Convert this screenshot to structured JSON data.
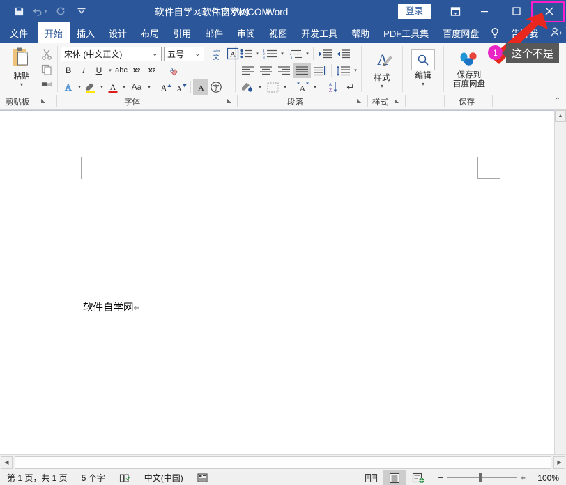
{
  "titlebar": {
    "quick_access": [
      {
        "name": "save-icon",
        "label": "保存"
      },
      {
        "name": "undo-icon",
        "label": "撤消"
      },
      {
        "name": "redo-icon",
        "label": "恢复"
      },
      {
        "name": "customize-qat-icon",
        "label": "自定义快速访问工具栏"
      }
    ],
    "document_title": "软件自学网：RJZXW.COM",
    "app_title_doc": "软件自学网",
    "app_title_sep": "-",
    "app_title": "Word",
    "signin_label": "登录",
    "ribbon_display_options": "功能区显示选项",
    "minimize_label": "最小化",
    "maximize_label": "最大化",
    "close_label": "关闭",
    "highlight_color": "#ff1ecb"
  },
  "tabs": [
    {
      "label": "文件",
      "active": false
    },
    {
      "label": "开始",
      "active": true
    },
    {
      "label": "插入",
      "active": false
    },
    {
      "label": "设计",
      "active": false
    },
    {
      "label": "布局",
      "active": false
    },
    {
      "label": "引用",
      "active": false
    },
    {
      "label": "邮件",
      "active": false
    },
    {
      "label": "审阅",
      "active": false
    },
    {
      "label": "视图",
      "active": false
    },
    {
      "label": "开发工具",
      "active": false
    },
    {
      "label": "帮助",
      "active": false
    },
    {
      "label": "PDF工具集",
      "active": false
    },
    {
      "label": "百度网盘",
      "active": false
    },
    {
      "label": "告诉我",
      "active": false
    }
  ],
  "tabs_right": {
    "share_label": "共享"
  },
  "ribbon": {
    "groups": [
      {
        "label": "剪贴板",
        "dialog_launcher": true
      },
      {
        "label": "字体",
        "dialog_launcher": true
      },
      {
        "label": "段落",
        "dialog_launcher": true
      },
      {
        "label": "样式",
        "dialog_launcher": true
      },
      {
        "label": "保存",
        "dialog_launcher": false
      }
    ],
    "clipboard": {
      "paste_label": "粘贴",
      "cut_label": "剪切",
      "copy_label": "复制",
      "format_painter_label": "格式刷"
    },
    "font": {
      "font_name_value": "宋体 (中文正文)",
      "font_size_value": "五号",
      "phonetic_guide_label": "拼音指南",
      "character_border_label": "字符边框",
      "bold_label": "B",
      "italic_label": "I",
      "underline_label": "U",
      "strikethrough_label": "abc",
      "subscript_label": "x₂",
      "superscript_label": "x²",
      "clear_format_label": "清除所有格式",
      "text_effects_label": "文本效果",
      "highlight_label": "文本突出显示颜色",
      "font_color_label": "字体颜色",
      "change_case_label": "Aa",
      "grow_font_label": "增大字号",
      "shrink_font_label": "减小字号",
      "char_shading_label": "字符底纹",
      "enclose_char_label": "带圈字符"
    },
    "paragraph": {
      "bullets_label": "项目符号",
      "numbering_label": "编号",
      "multilevel_label": "多级列表",
      "decrease_indent_label": "减少缩进量",
      "increase_indent_label": "增加缩进量",
      "align_left_label": "左对齐",
      "align_center_label": "居中",
      "align_right_label": "右对齐",
      "justify_label": "两端对齐",
      "distribute_label": "分散对齐",
      "line_spacing_label": "行和段落间距",
      "shading_label": "底纹",
      "borders_label": "边框",
      "chinese_layout_label": "中文版式",
      "sort_label": "排序",
      "show_marks_label": "显示编辑标记"
    },
    "styles": {
      "label_line1": "样式",
      "dropdown": "▾"
    },
    "editing": {
      "label_line1": "编辑",
      "dropdown": "▾"
    },
    "save_baidu": {
      "label_line1": "保存到",
      "label_line2": "百度网盘"
    },
    "collapse_ribbon_label": "折叠功能区"
  },
  "document": {
    "body_text": "软件自学网",
    "paragraph_mark": "↵"
  },
  "status": {
    "page_info": "第 1 页，共 1 页",
    "word_count": "5 个字",
    "proofing_label": "校对",
    "language": "中文(中国)",
    "accessibility_label": "辅助功能",
    "views": [
      {
        "name": "read-mode-view",
        "selected": false
      },
      {
        "name": "print-layout-view",
        "selected": true
      },
      {
        "name": "web-layout-view",
        "selected": false
      }
    ],
    "zoom_out": "−",
    "zoom_in": "+",
    "zoom_level": "100%"
  },
  "annotations": {
    "badge_number": "1",
    "tooltip_text": "这个不是",
    "arrow_color": "#e8281f",
    "badge_color": "#e925c6",
    "tooltip_bg": "#585858"
  }
}
